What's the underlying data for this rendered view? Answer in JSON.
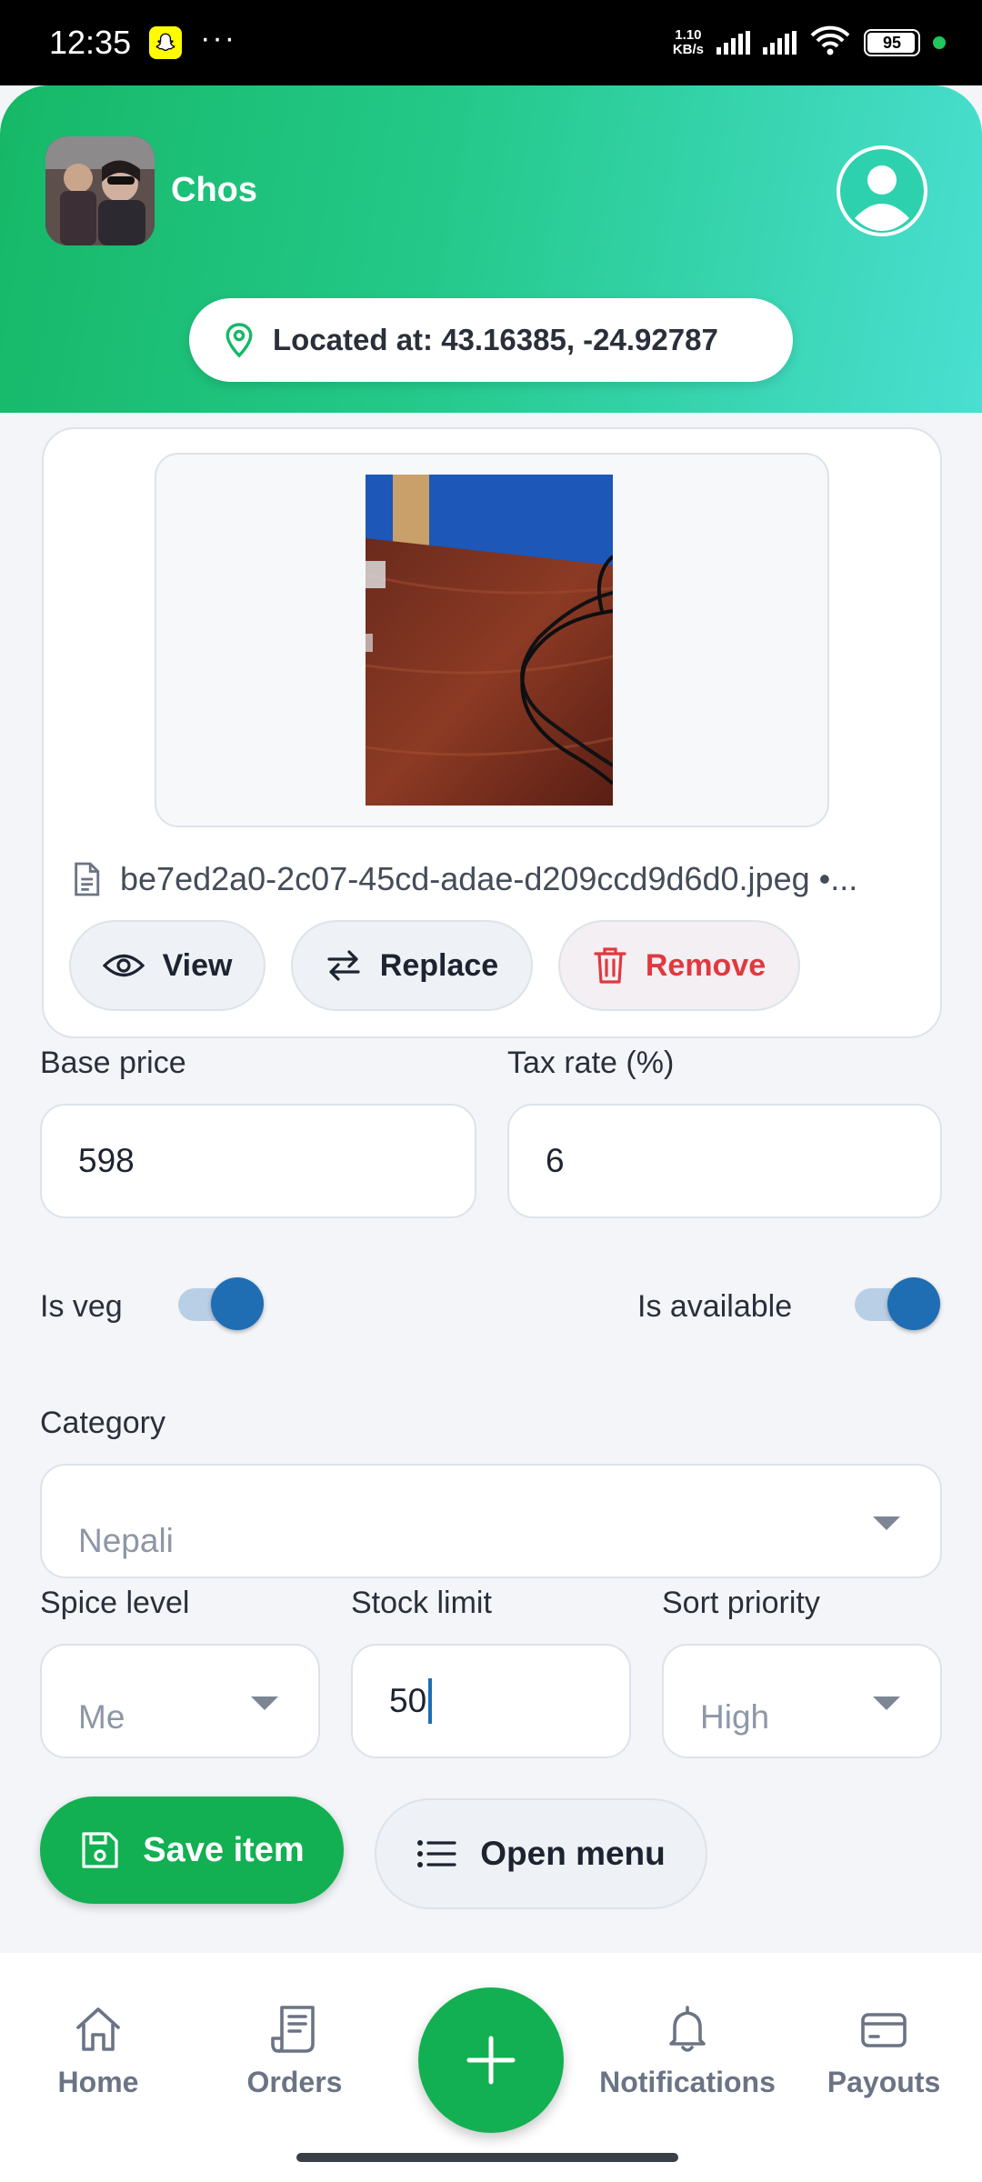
{
  "status_bar": {
    "time": "12:35",
    "more": "···",
    "net_speed_value": "1.10",
    "net_speed_unit": "KB/s",
    "battery": "95",
    "icons": [
      "snapchat-icon",
      "signal-icon",
      "signal-icon",
      "wifi-icon",
      "battery-icon"
    ]
  },
  "header": {
    "user_name": "Chos",
    "location": "Located at: 43.16385, -24.92787",
    "gradient": [
      "#16b867",
      "#4adfd2"
    ]
  },
  "image_card": {
    "file_name": "be7ed2a0-2c07-45cd-adae-d209ccd9d6d0.jpeg •...",
    "view_label": "View",
    "replace_label": "Replace",
    "remove_label": "Remove"
  },
  "form": {
    "base_price_label": "Base price",
    "base_price_value": "598",
    "tax_rate_label": "Tax rate (%)",
    "tax_rate_value": "6",
    "is_veg_label": "Is veg",
    "is_veg_on": true,
    "is_available_label": "Is available",
    "is_available_on": true,
    "category_label": "Category",
    "category_value": "Nepali",
    "spice_level_label": "Spice level",
    "spice_level_value": "Me",
    "stock_limit_label": "Stock limit",
    "stock_limit_value": "50",
    "sort_priority_label": "Sort priority",
    "sort_priority_value": "High"
  },
  "actions": {
    "save_label": "Save item",
    "open_menu_label": "Open menu"
  },
  "bottom_nav": {
    "home": "Home",
    "orders": "Orders",
    "notifications": "Notifications",
    "payouts": "Payouts"
  },
  "colors": {
    "primary_green": "#12b052",
    "toggle_blue": "#1f6db2",
    "danger_red": "#e0393f"
  }
}
